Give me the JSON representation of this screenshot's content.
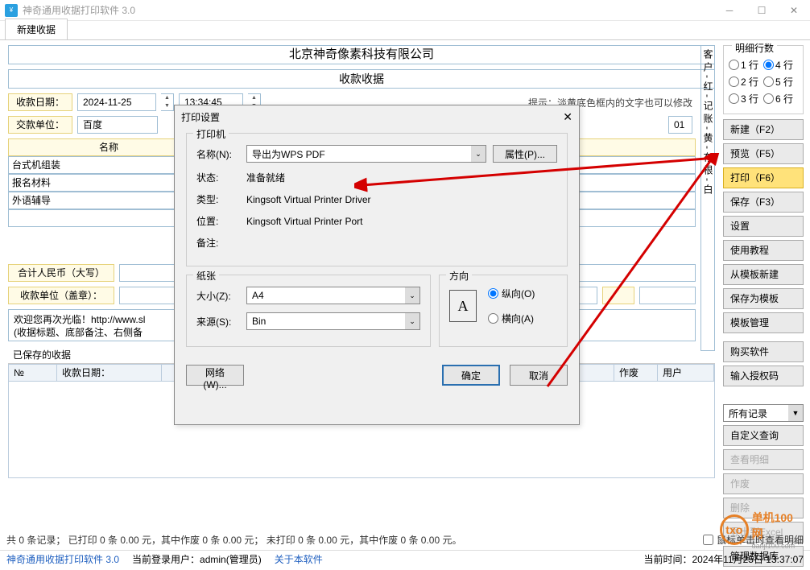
{
  "window": {
    "title": "神奇通用收据打印软件 3.0"
  },
  "tab": {
    "label": "新建收据"
  },
  "company": "北京神奇像素科技有限公司",
  "doc_title": "收款收据",
  "labels": {
    "date": "收款日期：",
    "payer": "交款单位：",
    "name": "名称",
    "total_cn": "合计人民币（大写）",
    "payee": "收款单位（盖章）："
  },
  "date": {
    "value": "2024-11-25",
    "time": "13:34:45"
  },
  "hint": "提示：淡黄底色框内的文字也可以修改",
  "payer_value": "百度",
  "no_suffix": "01",
  "items": [
    "台式机组装",
    "报名材料",
    "外语辅导"
  ],
  "vbar": "客户-红-记账-黄-存根-白",
  "welcome": "欢迎您再次光临！http://www.sl\n(收据标题、底部备注、右侧备",
  "rows_group": {
    "title": "明细行数",
    "opts": [
      "1 行",
      "2 行",
      "3 行",
      "4 行",
      "5 行",
      "6 行"
    ]
  },
  "side_btns": [
    "新建（F2）",
    "预览（F5）",
    "打印（F6）",
    "保存（F3）",
    "设置",
    "使用教程",
    "从模板新建",
    "保存为模板",
    "模板管理",
    "购买软件",
    "输入授权码"
  ],
  "side2_sel": "所有记录",
  "side2_btns": [
    "自定义查询",
    "查看明细",
    "作废",
    "删除",
    "导出到Excel",
    "管理数据库"
  ],
  "saved_hdr": "已保存的收据",
  "table_cols": [
    "№",
    "收款日期：",
    "",
    "作废",
    "用户"
  ],
  "summary": "共 0 条记录；   已打印 0 条 0.00 元，其中作废 0 条 0.00 元；   未打印 0 条 0.00 元，其中作废 0 条 0.00 元。",
  "chk": "鼠标单击时查看明细",
  "status": {
    "app": "神奇通用收据打印软件 3.0",
    "user": "当前登录用户：admin(管理员)",
    "about": "关于本软件",
    "time": "当前时间：2024年11月25日 13:37:07"
  },
  "dlg": {
    "title": "打印设置",
    "printer_cap": "打印机",
    "name_lbl": "名称(N):",
    "name_val": "导出为WPS PDF",
    "props": "属性(P)...",
    "status_lbl": "状态:",
    "status_val": "准备就绪",
    "type_lbl": "类型:",
    "type_val": "Kingsoft Virtual Printer Driver",
    "where_lbl": "位置:",
    "where_val": "Kingsoft Virtual Printer Port",
    "comment_lbl": "备注:",
    "paper_cap": "纸张",
    "size_lbl": "大小(Z):",
    "size_val": "A4",
    "source_lbl": "来源(S):",
    "source_val": "Bin",
    "orient_cap": "方向",
    "portrait": "纵向(O)",
    "landscape": "横向(A)",
    "network": "网络(W)...",
    "ok": "确定",
    "cancel": "取消"
  },
  "wm": {
    "cn": "单机100网",
    "en": "danji100.com"
  }
}
